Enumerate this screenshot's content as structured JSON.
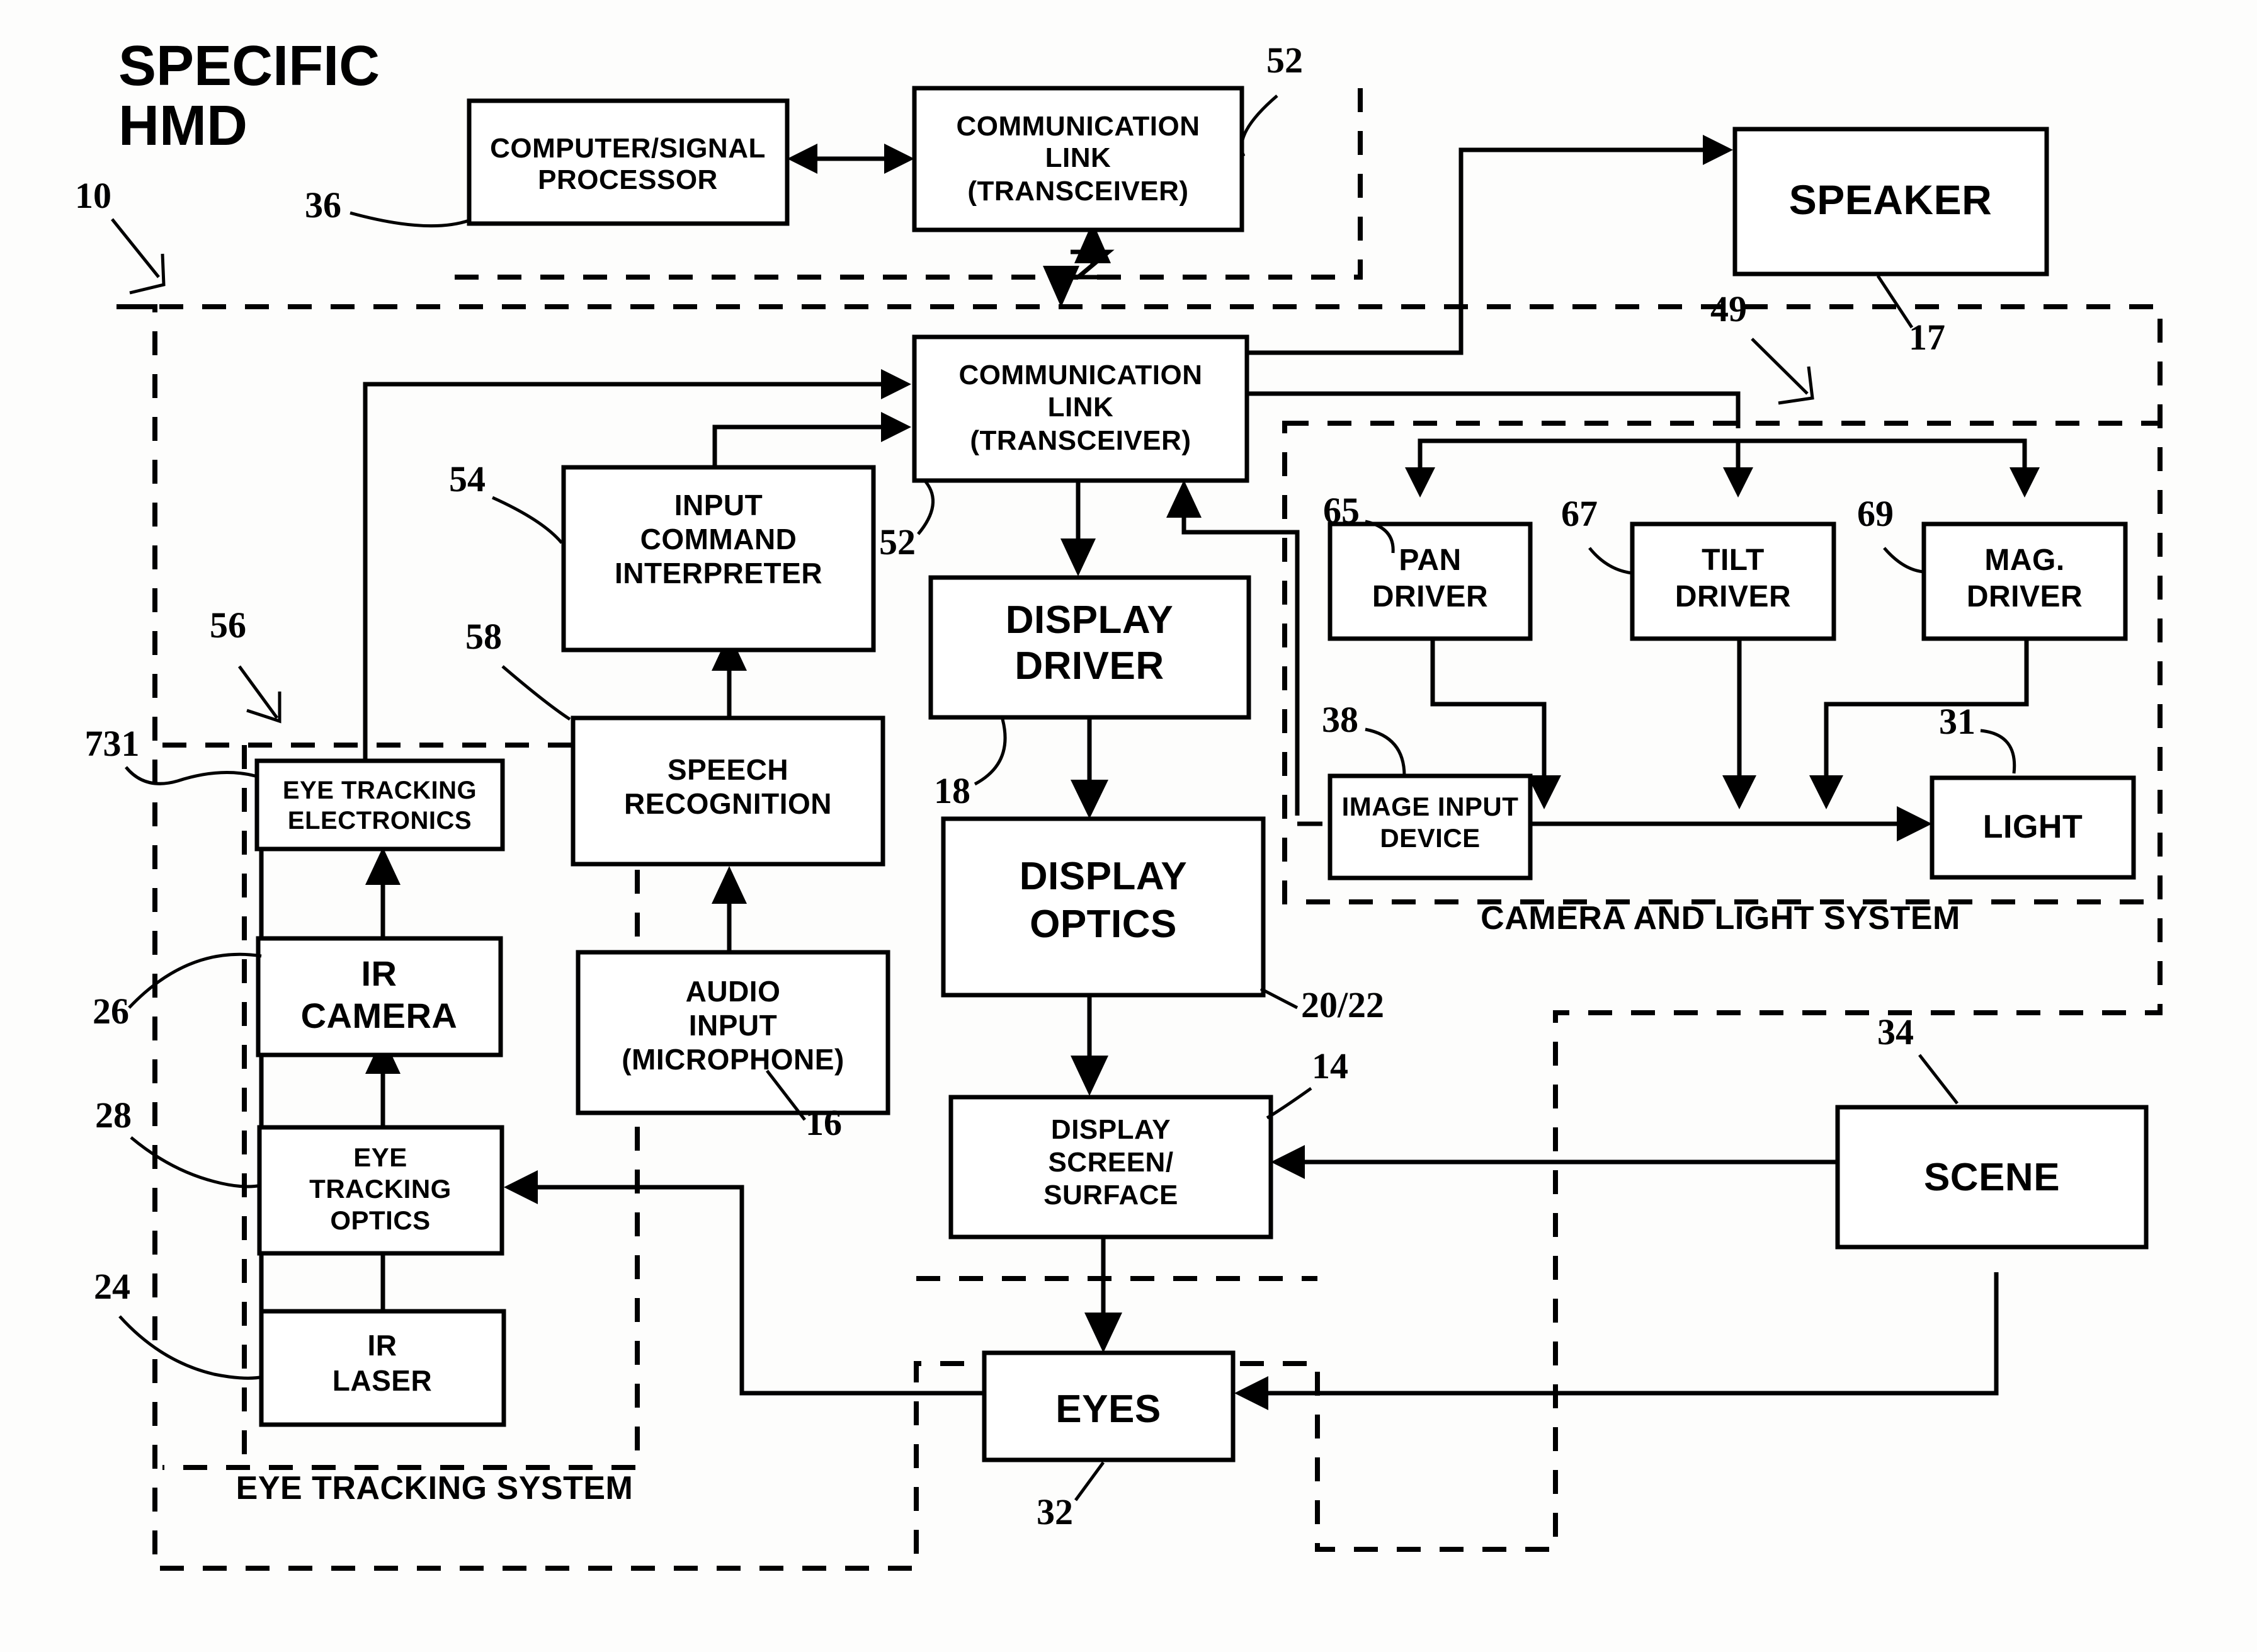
{
  "figure": {
    "title_line1": "SPECIFIC",
    "title_line2": "HMD",
    "root_ref": "10"
  },
  "boxes": {
    "computer_signal_processor": {
      "lines": [
        "COMPUTER/SIGNAL",
        "PROCESSOR"
      ],
      "ref": "36"
    },
    "comm_link_top": {
      "lines": [
        "COMMUNICATION",
        "LINK",
        "(TRANSCEIVER)"
      ],
      "ref": "52"
    },
    "speaker": {
      "lines": [
        "SPEAKER"
      ],
      "ref": "17"
    },
    "comm_link_hmd": {
      "lines": [
        "COMMUNICATION",
        "LINK",
        "(TRANSCEIVER)"
      ],
      "ref": "52"
    },
    "input_command_interpreter": {
      "lines": [
        "INPUT",
        "COMMAND",
        "INTERPRETER"
      ],
      "ref": "54"
    },
    "speech_recognition": {
      "lines": [
        "SPEECH",
        "RECOGNITION"
      ],
      "ref": "58"
    },
    "audio_input": {
      "lines": [
        "AUDIO",
        "INPUT",
        "(MICROPHONE)"
      ],
      "ref": "16"
    },
    "eye_tracking_electronics": {
      "lines": [
        "EYE TRACKING",
        "ELECTRONICS"
      ],
      "ref": "731"
    },
    "ir_camera": {
      "lines": [
        "IR",
        "CAMERA"
      ],
      "ref": "26"
    },
    "eye_tracking_optics": {
      "lines": [
        "EYE",
        "TRACKING",
        "OPTICS"
      ],
      "ref": "28"
    },
    "ir_laser": {
      "lines": [
        "IR",
        "LASER"
      ],
      "ref": "24"
    },
    "display_driver": {
      "lines": [
        "DISPLAY",
        "DRIVER"
      ],
      "ref": "18"
    },
    "display_optics": {
      "lines": [
        "DISPLAY",
        "OPTICS"
      ],
      "ref": "20/22"
    },
    "display_screen_surface": {
      "lines": [
        "DISPLAY",
        "SCREEN/",
        "SURFACE"
      ],
      "ref": "14"
    },
    "eyes": {
      "lines": [
        "EYES"
      ],
      "ref": "32"
    },
    "pan_driver": {
      "lines": [
        "PAN",
        "DRIVER"
      ],
      "ref": "65"
    },
    "tilt_driver": {
      "lines": [
        "TILT",
        "DRIVER"
      ],
      "ref": "67"
    },
    "mag_driver": {
      "lines": [
        "MAG.",
        "DRIVER"
      ],
      "ref": "69"
    },
    "image_input_device": {
      "lines": [
        "IMAGE INPUT",
        "DEVICE"
      ],
      "ref": "38"
    },
    "light": {
      "lines": [
        "LIGHT"
      ],
      "ref": "31"
    },
    "scene": {
      "lines": [
        "SCENE"
      ],
      "ref": "34"
    }
  },
  "system_labels": {
    "eye_tracking_system": "EYE TRACKING SYSTEM",
    "camera_and_light_system": "CAMERA AND LIGHT SYSTEM",
    "camera_light_ref": "49",
    "eye_tracking_ref": "56"
  },
  "refs": {
    "r10": "10",
    "r36": "36",
    "r52_top": "52",
    "r52_hmd": "52",
    "r17": "17",
    "r49": "49",
    "r54": "54",
    "r56": "56",
    "r58": "58",
    "r731": "731",
    "r26": "26",
    "r28": "28",
    "r24": "24",
    "r18": "18",
    "r2022": "20/22",
    "r14": "14",
    "r32": "32",
    "r16": "16",
    "r65": "65",
    "r67": "67",
    "r69": "69",
    "r38": "38",
    "r31": "31",
    "r34": "34"
  }
}
